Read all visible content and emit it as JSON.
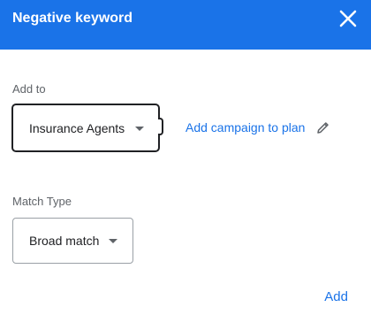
{
  "dialog": {
    "title": "Negative keyword",
    "close_icon": "close-icon"
  },
  "add_to": {
    "label": "Add to",
    "selected": "Insurance Agents",
    "link": "Add campaign to plan",
    "edit_icon": "pencil-icon"
  },
  "match_type": {
    "label": "Match Type",
    "selected": "Broad match"
  },
  "actions": {
    "add_label": "Add"
  },
  "colors": {
    "header_bg": "#1a73e8",
    "link": "#1a73e8",
    "text": "#202124"
  }
}
